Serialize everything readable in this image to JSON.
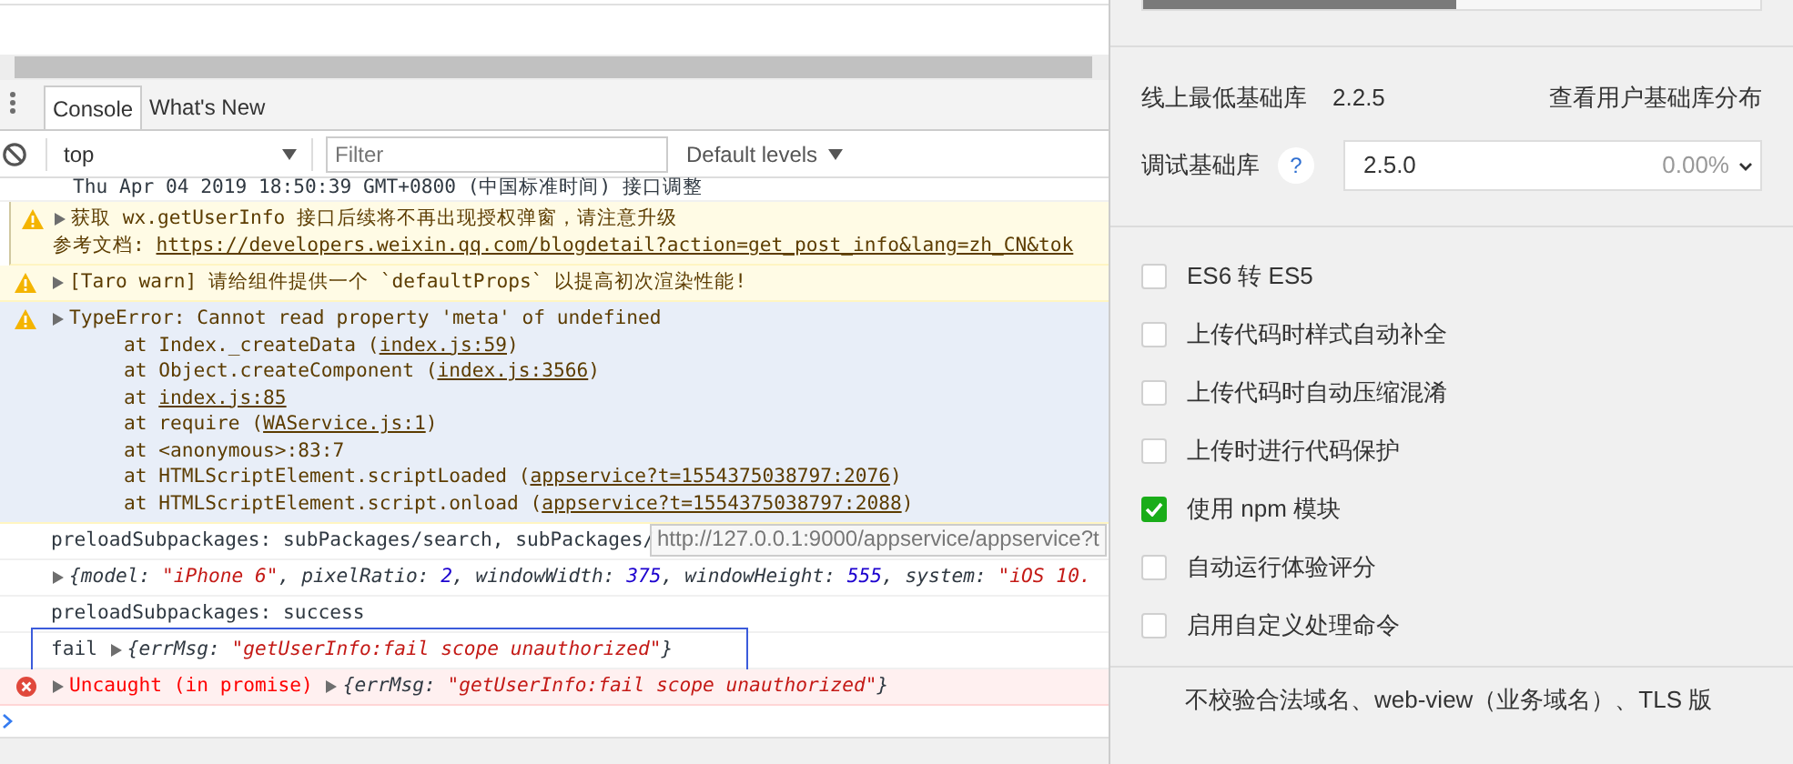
{
  "tabs": [
    {
      "label": "Console",
      "selected": true
    },
    {
      "label": "What's New",
      "selected": false
    }
  ],
  "toolbar": {
    "context": "top",
    "filter": {
      "placeholder": "Filter"
    },
    "levels": "Default levels"
  },
  "messages": [
    {
      "kind": "cut",
      "lines": [
        [
          {
            "kind": "text",
            "text": "Thu Apr 04 2019 18:50:39 GMT+0800 (中国标准时间) 接口调整"
          }
        ]
      ]
    },
    {
      "kind": "nested-warning",
      "expanded": false,
      "lines": [
        [
          {
            "kind": "text",
            "text": "获取 wx.getUserInfo 接口后续将不再出现授权弹窗，请注意升级"
          }
        ],
        [
          {
            "kind": "text",
            "text": "参考文档: "
          },
          {
            "kind": "link",
            "text": "https://developers.weixin.qq.com/blogdetail?action=get_post_info&lang=zh_CN&tok"
          }
        ]
      ]
    },
    {
      "kind": "warning",
      "expanded": false,
      "lines": [
        [
          {
            "kind": "text",
            "text": "[Taro warn] 请给组件提供一个 `defaultProps` 以提高初次渲染性能!"
          }
        ]
      ]
    },
    {
      "kind": "stack-warning",
      "expanded": false,
      "lines": [
        [
          {
            "kind": "text",
            "text": "TypeError: Cannot read property 'meta' of undefined"
          }
        ]
      ],
      "stack": [
        [
          {
            "kind": "text",
            "text": "at Index._createData ("
          },
          {
            "kind": "link",
            "text": "index.js:59"
          },
          {
            "kind": "text",
            "text": ")"
          }
        ],
        [
          {
            "kind": "text",
            "text": "at Object.createComponent ("
          },
          {
            "kind": "link",
            "text": "index.js:3566"
          },
          {
            "kind": "text",
            "text": ")"
          }
        ],
        [
          {
            "kind": "text",
            "text": "at "
          },
          {
            "kind": "link",
            "text": "index.js:85"
          }
        ],
        [
          {
            "kind": "text",
            "text": "at require ("
          },
          {
            "kind": "link",
            "text": "WAService.js:1"
          },
          {
            "kind": "text",
            "text": ")"
          }
        ],
        [
          {
            "kind": "text",
            "text": "at <anonymous>:83:7"
          }
        ],
        [
          {
            "kind": "text",
            "text": "at HTMLScriptElement.scriptLoaded ("
          },
          {
            "kind": "link",
            "text": "appservice?t=1554375038797:2076"
          },
          {
            "kind": "text",
            "text": ")"
          }
        ],
        [
          {
            "kind": "text",
            "text": "at HTMLScriptElement.script.onload ("
          },
          {
            "kind": "link",
            "text": "appservice?t=1554375038797:2088"
          },
          {
            "kind": "text",
            "text": ")"
          }
        ]
      ]
    },
    {
      "kind": "log",
      "tooltip": "http://127.0.0.1:9000/appservice/appservice?t",
      "lines": [
        [
          {
            "kind": "text",
            "text": "preloadSubpackages: subPackages/search, subPackages/"
          }
        ]
      ]
    },
    {
      "kind": "log",
      "expanded": false,
      "lines": [
        [
          {
            "kind": "key",
            "text": "{model: "
          },
          {
            "kind": "string",
            "text": "\"iPhone 6\""
          },
          {
            "kind": "key",
            "text": ", pixelRatio: "
          },
          {
            "kind": "number",
            "text": "2"
          },
          {
            "kind": "key",
            "text": ", windowWidth: "
          },
          {
            "kind": "number",
            "text": "375"
          },
          {
            "kind": "key",
            "text": ", windowHeight: "
          },
          {
            "kind": "number",
            "text": "555"
          },
          {
            "kind": "key",
            "text": ", system: "
          },
          {
            "kind": "string",
            "text": "\"iOS 10."
          }
        ]
      ]
    },
    {
      "kind": "log",
      "lines": [
        [
          {
            "kind": "text",
            "text": "preloadSubpackages: success"
          }
        ]
      ]
    },
    {
      "kind": "log",
      "boxed": true,
      "lines": [
        [
          {
            "kind": "text",
            "text": "fail "
          },
          {
            "kind": "arrow",
            "expanded": false
          },
          {
            "kind": "key",
            "text": "{errMsg: "
          },
          {
            "kind": "string",
            "text": "\"getUserInfo:fail scope unauthorized\""
          },
          {
            "kind": "key",
            "text": "}"
          }
        ]
      ]
    },
    {
      "kind": "error",
      "expanded": false,
      "lines": [
        [
          {
            "kind": "text",
            "text": "Uncaught (in promise) "
          },
          {
            "kind": "arrow",
            "expanded": false
          },
          {
            "kind": "key",
            "text": "{errMsg: "
          },
          {
            "kind": "string",
            "text": "\"getUserInfo:fail scope unauthorized\""
          },
          {
            "kind": "key",
            "text": "}"
          }
        ]
      ]
    }
  ],
  "settings": {
    "min_lib_label": "线上最低基础库",
    "min_lib_value": "2.2.5",
    "distribution_link": "查看用户基础库分布",
    "debug_lib_label": "调试基础库",
    "help": "?",
    "debug_lib": {
      "value": "2.5.0",
      "share": "0.00%"
    },
    "options": [
      {
        "label": "ES6 转 ES5",
        "checked": false
      },
      {
        "label": "上传代码时样式自动补全",
        "checked": false
      },
      {
        "label": "上传代码时自动压缩混淆",
        "checked": false
      },
      {
        "label": "上传时进行代码保护",
        "checked": false
      },
      {
        "label": "使用 npm 模块",
        "checked": true
      },
      {
        "label": "自动运行体验评分",
        "checked": false
      },
      {
        "label": "启用自定义处理命令",
        "checked": false
      }
    ],
    "footer": "不校验合法域名、web-view（业务域名）、TLS 版"
  }
}
